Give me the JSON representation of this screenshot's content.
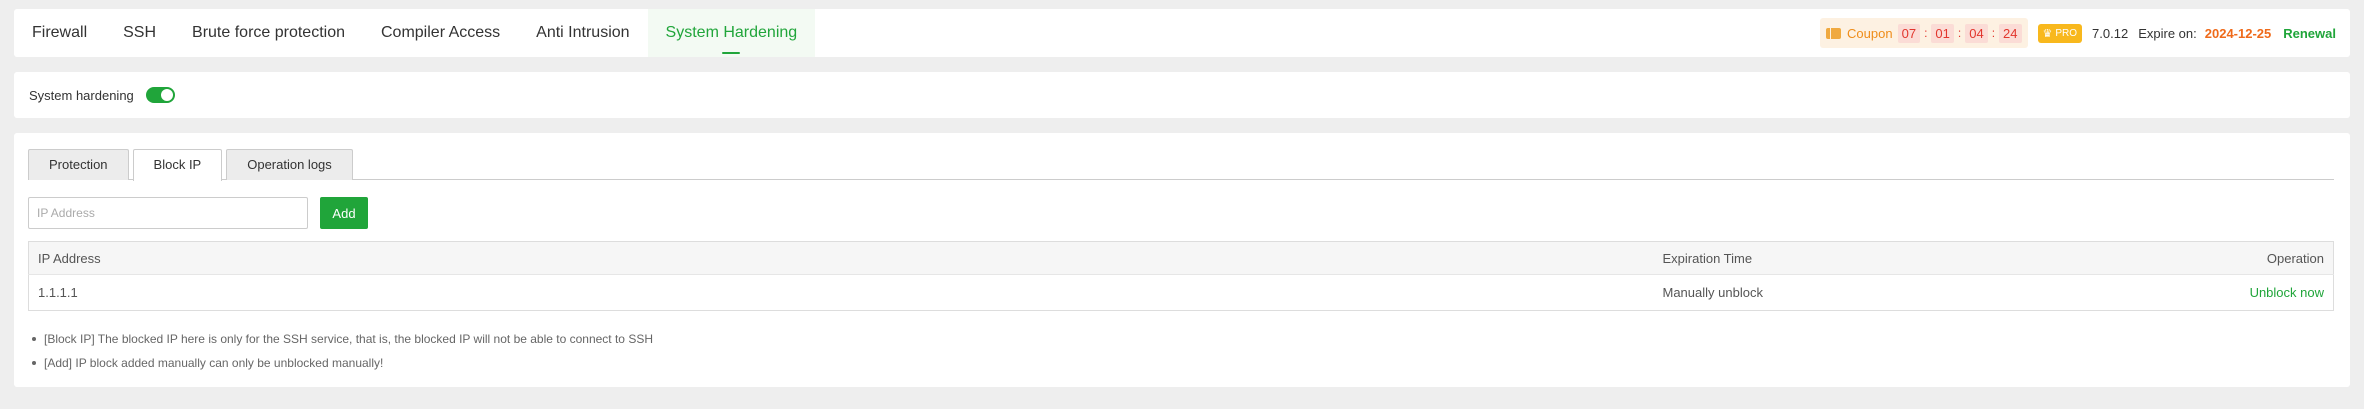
{
  "nav": {
    "items": [
      {
        "label": "Firewall",
        "active": false
      },
      {
        "label": "SSH",
        "active": false
      },
      {
        "label": "Brute force protection",
        "active": false
      },
      {
        "label": "Compiler Access",
        "active": false
      },
      {
        "label": "Anti Intrusion",
        "active": false
      },
      {
        "label": "System Hardening",
        "active": true
      }
    ]
  },
  "header": {
    "coupon_label": "Coupon",
    "countdown": [
      "07",
      "01",
      "04",
      "24"
    ],
    "pro_label": "PRO",
    "version": "7.0.12",
    "expire_label": "Expire on:",
    "expire_date": "2024-12-25",
    "renewal_label": "Renewal"
  },
  "hardening": {
    "label": "System hardening",
    "enabled": true
  },
  "tabs": [
    {
      "label": "Protection",
      "active": false
    },
    {
      "label": "Block IP",
      "active": true
    },
    {
      "label": "Operation logs",
      "active": false
    }
  ],
  "form": {
    "ip_placeholder": "IP Address",
    "ip_value": "",
    "add_label": "Add"
  },
  "table": {
    "headers": {
      "ip": "IP Address",
      "expiration": "Expiration Time",
      "operation": "Operation"
    },
    "rows": [
      {
        "ip": "1.1.1.1",
        "expiration": "Manually unblock",
        "action": "Unblock now"
      }
    ]
  },
  "notes": [
    "[Block IP] The blocked IP here is only for the SSH service, that is, the blocked IP will not be able to connect to SSH",
    "[Add] IP block added manually can only be unblocked manually!"
  ],
  "colors": {
    "accent": "#20a53a",
    "coupon": "#ef8d1a",
    "countdown": "#e2362d",
    "pro": "#f8b81d",
    "expire_date": "#ef6a1a"
  }
}
